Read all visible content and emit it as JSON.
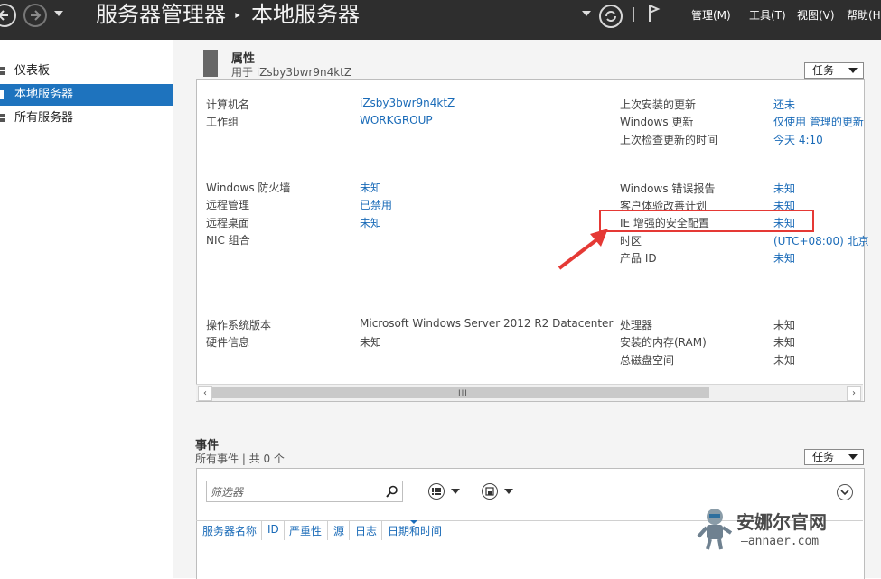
{
  "titlebar": {
    "breadcrumb_root": "服务器管理器",
    "breadcrumb_sep": "‣",
    "breadcrumb_current": "本地服务器",
    "menu": [
      "管理(M)",
      "工具(T)",
      "视图(V)",
      "帮助(H)"
    ]
  },
  "sidebar": {
    "items": [
      {
        "label": "仪表板"
      },
      {
        "label": "本地服务器"
      },
      {
        "label": "所有服务器"
      }
    ]
  },
  "properties": {
    "title": "属性",
    "subtitle": "用于 iZsby3bwr9n4ktZ",
    "tasks_label": "任务",
    "left": [
      {
        "label": "计算机名",
        "value": "iZsby3bwr9n4ktZ"
      },
      {
        "label": "工作组",
        "value": "WORKGROUP"
      },
      {
        "label": "Windows 防火墙",
        "value": "未知"
      },
      {
        "label": "远程管理",
        "value": "已禁用"
      },
      {
        "label": "远程桌面",
        "value": "未知"
      },
      {
        "label": "NIC 组合",
        "value": ""
      },
      {
        "label": "操作系统版本",
        "value": "Microsoft Windows Server 2012 R2 Datacenter"
      },
      {
        "label": "硬件信息",
        "value": "未知"
      }
    ],
    "right": [
      {
        "label": "上次安装的更新",
        "value": "还未"
      },
      {
        "label": "Windows 更新",
        "value": "仅使用 管理的更新"
      },
      {
        "label": "上次检查更新的时间",
        "value": "今天 4:10"
      },
      {
        "label": "Windows 错误报告",
        "value": "未知"
      },
      {
        "label": "客户体验改善计划",
        "value": "未知"
      },
      {
        "label": "IE 增强的安全配置",
        "value": "未知"
      },
      {
        "label": "时区",
        "value": "(UTC+08:00) 北京"
      },
      {
        "label": "产品 ID",
        "value": "未知"
      },
      {
        "label": "处理器",
        "value": "未知"
      },
      {
        "label": "安装的内存(RAM)",
        "value": "未知"
      },
      {
        "label": "总磁盘空间",
        "value": "未知"
      }
    ]
  },
  "scrollbar": {
    "grip": "III"
  },
  "events": {
    "title": "事件",
    "subtitle": "所有事件 | 共 0 个",
    "tasks_label": "任务",
    "filter_placeholder": "筛选器",
    "columns": [
      "服务器名称",
      "ID",
      "严重性",
      "源",
      "日志",
      "日期和时间"
    ]
  },
  "watermark": {
    "text": "安娜尔官网",
    "url": "—annaer.com"
  },
  "colors": {
    "accent": "#1e73be",
    "highlight": "#e53935",
    "link": "#1a6bb8"
  }
}
